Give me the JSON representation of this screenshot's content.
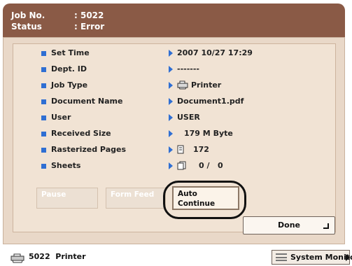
{
  "header": {
    "job_no_label": "Job No.",
    "job_no_value": ": 5022",
    "status_label": "Status",
    "status_value": ": Error"
  },
  "details": [
    {
      "label": "Set Time",
      "value": "2007 10/27 17:29",
      "icon": ""
    },
    {
      "label": "Dept. ID",
      "value": "-------",
      "icon": ""
    },
    {
      "label": "Job Type",
      "value": "Printer",
      "icon": "printer-icon"
    },
    {
      "label": "Document Name",
      "value": "Document1.pdf",
      "icon": ""
    },
    {
      "label": "User",
      "value": "USER",
      "icon": ""
    },
    {
      "label": "Received Size",
      "value": "179 M Byte",
      "icon": ""
    },
    {
      "label": "Rasterized Pages",
      "value": "172",
      "icon": "page-icon"
    },
    {
      "label": "Sheets",
      "value": "0 /   0",
      "icon": "sheets-icon"
    }
  ],
  "buttons": {
    "pause": "Pause",
    "form_feed": "Form Feed",
    "auto_continue_line1": "Auto",
    "auto_continue_line2": "Continue",
    "done": "Done"
  },
  "statusbar": {
    "job_text": "5022  Printer",
    "system_monitor": "System Monitor"
  },
  "colors": {
    "header_bg": "#8a5a46",
    "panel_bg": "#e9d8c8",
    "bullet": "#2f6fd3"
  }
}
